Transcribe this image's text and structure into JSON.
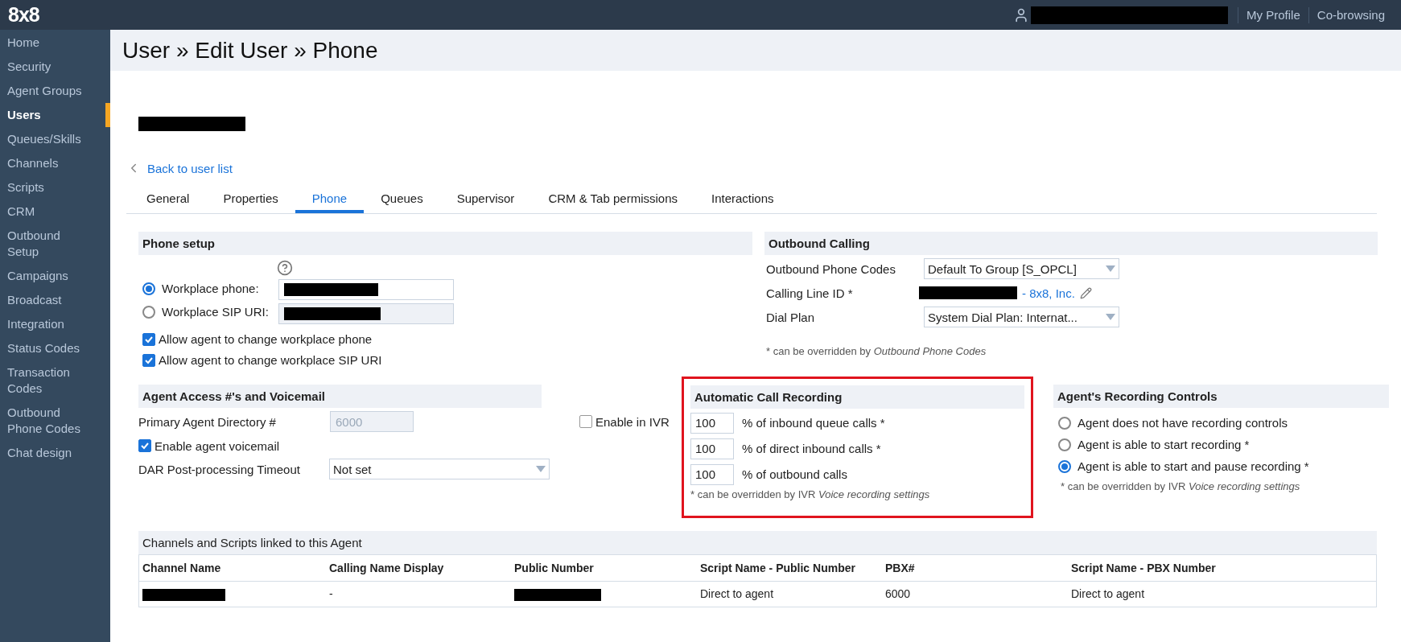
{
  "top_bar": {
    "logo": "8x8",
    "links": [
      "My Profile",
      "Co-browsing"
    ]
  },
  "sidebar": {
    "items": [
      {
        "label": "Home",
        "selected": false
      },
      {
        "label": "Security",
        "selected": false
      },
      {
        "label": "Agent Groups",
        "selected": false
      },
      {
        "label": "Users",
        "selected": true
      },
      {
        "label": "Queues/Skills",
        "selected": false
      },
      {
        "label": "Channels",
        "selected": false
      },
      {
        "label": "Scripts",
        "selected": false
      },
      {
        "label": "CRM",
        "selected": false
      },
      {
        "label": "Outbound Setup",
        "selected": false
      },
      {
        "label": "Campaigns",
        "selected": false
      },
      {
        "label": "Broadcast",
        "selected": false
      },
      {
        "label": "Integration",
        "selected": false
      },
      {
        "label": "Status Codes",
        "selected": false
      },
      {
        "label": "Transaction Codes",
        "selected": false
      },
      {
        "label": "Outbound Phone Codes",
        "selected": false
      },
      {
        "label": "Chat design",
        "selected": false
      }
    ]
  },
  "page_title": "User » Edit User » Phone",
  "back_link": "Back to user list",
  "tabs": [
    {
      "label": "General",
      "selected": false
    },
    {
      "label": "Properties",
      "selected": false
    },
    {
      "label": "Phone",
      "selected": true
    },
    {
      "label": "Queues",
      "selected": false
    },
    {
      "label": "Supervisor",
      "selected": false
    },
    {
      "label": "CRM & Tab permissions",
      "selected": false
    },
    {
      "label": "Interactions",
      "selected": false
    }
  ],
  "phone_setup": {
    "title": "Phone setup",
    "options": [
      {
        "label": "Workplace phone:",
        "selected": true,
        "disabled": false
      },
      {
        "label": "Workplace SIP URI:",
        "selected": false,
        "disabled": true
      }
    ],
    "checkboxes": [
      {
        "label": "Allow agent to change workplace phone",
        "checked": true
      },
      {
        "label": "Allow agent to change workplace SIP URI",
        "checked": true
      }
    ]
  },
  "outbound_calling": {
    "title": "Outbound Calling",
    "phone_codes": {
      "label": "Outbound Phone Codes",
      "value": "Default To Group [S_OPCL]"
    },
    "calling_line_id": {
      "label": "Calling Line ID *",
      "link": "- 8x8, Inc."
    },
    "dial_plan": {
      "label": "Dial Plan",
      "value": "System Dial Plan: Internat..."
    },
    "note": "* can be overridden by *Outbound Phone Codes*"
  },
  "agent_access": {
    "title": "Agent Access #'s and Voicemail",
    "directory": {
      "label": "Primary Agent Directory #",
      "value": "6000"
    },
    "enable_ivr": {
      "label": "Enable in IVR",
      "checked": false
    },
    "voicemail": {
      "label": "Enable agent voicemail",
      "checked": true
    },
    "dar_timeout": {
      "label": "DAR Post-processing Timeout",
      "value": "Not set"
    }
  },
  "call_recording": {
    "title": "Automatic Call Recording",
    "rows": [
      {
        "value": "100",
        "label": "% of inbound queue calls *"
      },
      {
        "value": "100",
        "label": "% of direct inbound calls *"
      },
      {
        "value": "100",
        "label": "% of outbound calls"
      }
    ],
    "note": "* can be overridden by IVR *Voice recording settings*"
  },
  "recording_controls": {
    "title": "Agent's Recording Controls",
    "options": [
      {
        "label": "Agent does not have recording controls",
        "selected": false
      },
      {
        "label": "Agent is able to start recording *",
        "selected": false
      },
      {
        "label": "Agent is able to start and pause recording *",
        "selected": true
      }
    ],
    "note": "* can be overridden by IVR *Voice recording settings*"
  },
  "linked_table": {
    "title": "Channels and Scripts linked to this Agent",
    "columns": [
      "Channel Name",
      "Calling Name Display",
      "Public Number",
      "Script Name - Public Number",
      "PBX#",
      "Script Name - PBX Number"
    ],
    "rows": [
      {
        "cells": [
          {
            "kind": "redacted"
          },
          {
            "kind": "text",
            "text": "-"
          },
          {
            "kind": "redacted"
          },
          {
            "kind": "text",
            "text": "Direct to agent"
          },
          {
            "kind": "text",
            "text": "6000"
          },
          {
            "kind": "text",
            "text": "Direct to agent"
          }
        ]
      }
    ]
  }
}
